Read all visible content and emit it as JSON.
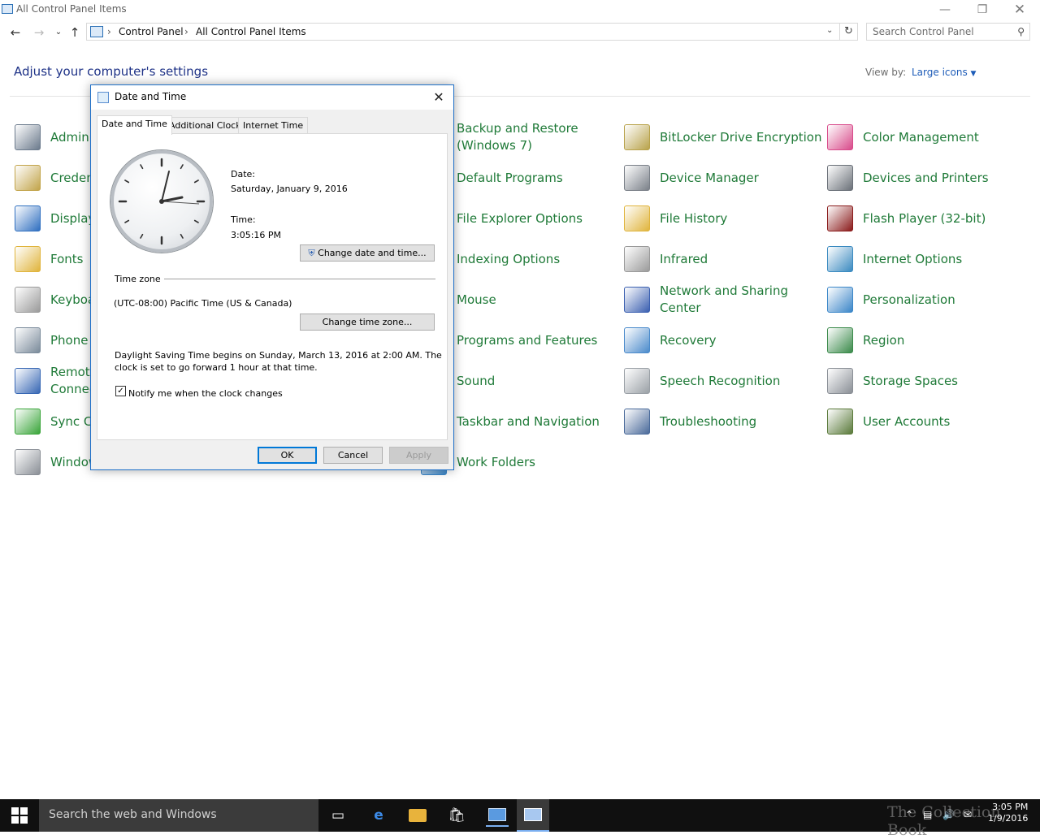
{
  "window": {
    "title": "All Control Panel Items"
  },
  "breadcrumb": [
    "Control Panel",
    "All Control Panel Items"
  ],
  "search": {
    "placeholder": "Search Control Panel"
  },
  "main": {
    "heading": "Adjust your computer's settings",
    "view_by_label": "View by:",
    "view_by_value": "Large icons"
  },
  "items": [
    {
      "label": "Admini",
      "color": "#6b7a8c"
    },
    {
      "label": "Creden",
      "color": "#c2a44a"
    },
    {
      "label": "Display",
      "color": "#2f6fc0"
    },
    {
      "label": "Fonts",
      "color": "#e0b43c"
    },
    {
      "label": "Keyboa",
      "color": "#9a9a9a"
    },
    {
      "label": "Phone",
      "color": "#7a8a9a"
    },
    {
      "label": "Remote\nConnec",
      "color": "#3767b4"
    },
    {
      "label": "Sync Ce",
      "color": "#3aa53a"
    },
    {
      "label": "Window",
      "color": "#8a8f96"
    },
    {
      "label": "Backup and Restore\n(Windows 7)",
      "color": "#4a8a4a"
    },
    {
      "label": "Default Programs",
      "color": "#3a7bd5"
    },
    {
      "label": "File Explorer Options",
      "color": "#e8c15a"
    },
    {
      "label": "Indexing Options",
      "color": "#7a8a9a"
    },
    {
      "label": "Mouse",
      "color": "#9aa0a6"
    },
    {
      "label": "Programs and Features",
      "color": "#6f8fb0"
    },
    {
      "label": "Sound",
      "color": "#9aa0a6"
    },
    {
      "label": "Taskbar and Navigation",
      "color": "#5a6a7a"
    },
    {
      "label": "Work Folders",
      "color": "#3a86c8"
    },
    {
      "label": "BitLocker Drive Encryption",
      "color": "#b8a24a"
    },
    {
      "label": "Device Manager",
      "color": "#7a8088"
    },
    {
      "label": "File History",
      "color": "#e0b43c"
    },
    {
      "label": "Infrared",
      "color": "#9a9a9a"
    },
    {
      "label": "Network and Sharing\nCenter",
      "color": "#3a5fb0"
    },
    {
      "label": "Recovery",
      "color": "#4a8acb"
    },
    {
      "label": "Speech Recognition",
      "color": "#9aa0a6"
    },
    {
      "label": "Troubleshooting",
      "color": "#4a6a9a"
    },
    {
      "label": "Color Management",
      "color": "#d84a8a"
    },
    {
      "label": "Devices and Printers",
      "color": "#6a7078"
    },
    {
      "label": "Flash Player (32-bit)",
      "color": "#8a1a1a"
    },
    {
      "label": "Internet Options",
      "color": "#3a8ac0"
    },
    {
      "label": "Personalization",
      "color": "#3a86c8"
    },
    {
      "label": "Region",
      "color": "#3a8a4a"
    },
    {
      "label": "Storage Spaces",
      "color": "#8a8f96"
    },
    {
      "label": "User Accounts",
      "color": "#5a7a3a"
    }
  ],
  "dialog": {
    "title": "Date and Time",
    "tabs": [
      "Date and Time",
      "Additional Clocks",
      "Internet Time"
    ],
    "date_label": "Date:",
    "date_value": "Saturday, January 9, 2016",
    "time_label": "Time:",
    "time_value": "3:05:16 PM",
    "change_datetime_button": "Change date and time...",
    "timezone_label": "Time zone",
    "timezone_value": "(UTC-08:00) Pacific Time (US & Canada)",
    "change_timezone_button": "Change time zone...",
    "dst_line1": "Daylight Saving Time begins on Sunday, March 13, 2016 at 2:00 AM. The",
    "dst_line2": "clock is set to go forward 1 hour at that time.",
    "notify_label": "Notify me when the clock changes",
    "notify_checked": true,
    "ok": "OK",
    "cancel": "Cancel",
    "apply": "Apply"
  },
  "taskbar": {
    "search_placeholder": "Search the web and Windows",
    "clock_time": "3:05 PM",
    "clock_date": "1/9/2016",
    "watermark": "The Collection Book"
  }
}
